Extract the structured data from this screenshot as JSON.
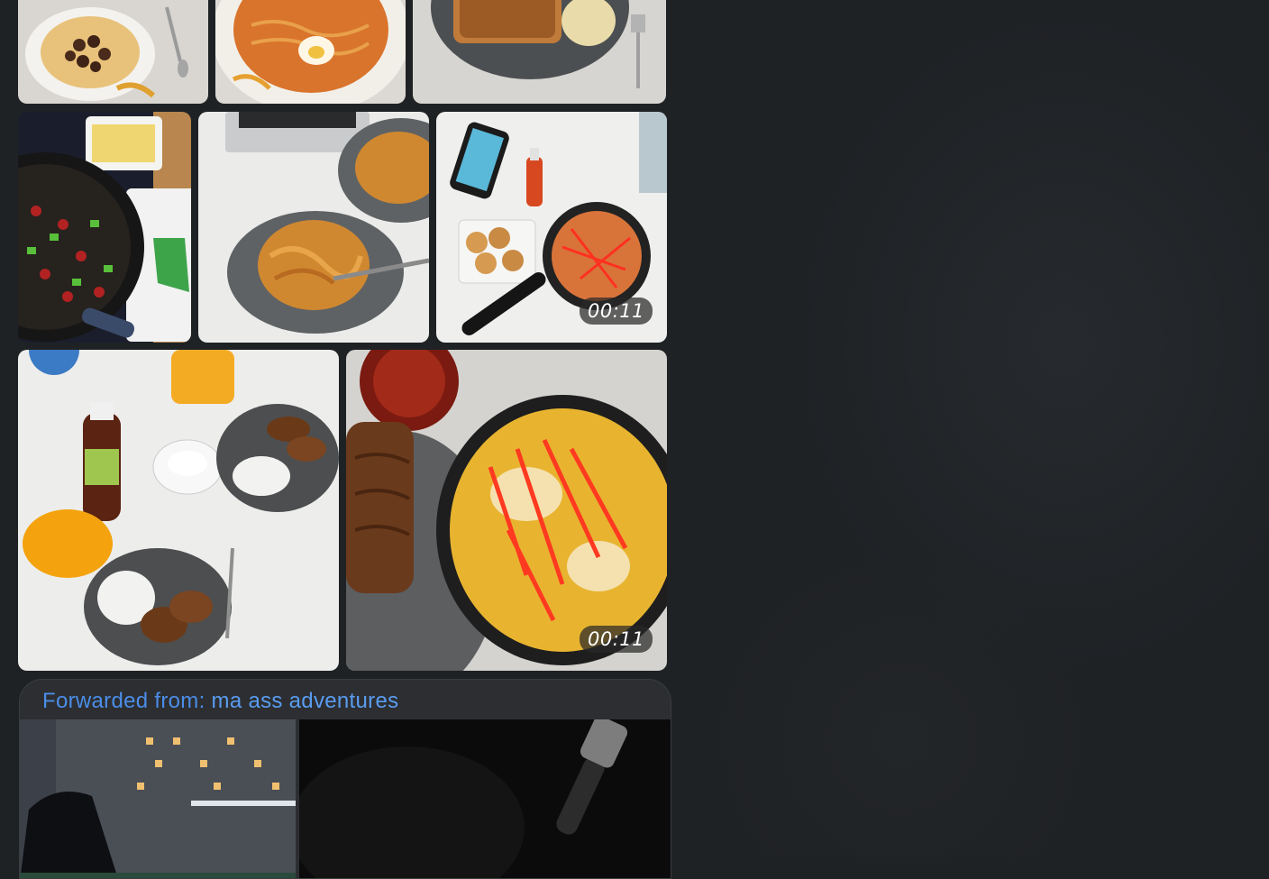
{
  "media": [
    {
      "id": "cereal-bowl",
      "kind": "photo"
    },
    {
      "id": "noodle-soup-with-egg",
      "kind": "photo"
    },
    {
      "id": "toast-sandwich",
      "kind": "photo"
    },
    {
      "id": "sausage-pan-cooking",
      "kind": "photo"
    },
    {
      "id": "tagliatelle-plates",
      "kind": "photo"
    },
    {
      "id": "pasta-pan-with-phone",
      "kind": "video",
      "duration": "00:11"
    },
    {
      "id": "rice-and-cutlets",
      "kind": "photo"
    },
    {
      "id": "omelette-pan-with-tea",
      "kind": "video",
      "duration": "00:11"
    }
  ],
  "forwarded": {
    "prefix": "Forwarded from:",
    "source": "ma ass adventures",
    "media": [
      {
        "id": "night-building",
        "kind": "photo"
      },
      {
        "id": "dark-photo",
        "kind": "photo"
      }
    ]
  },
  "colors": {
    "background": "#1f2225",
    "bubble": "#2c2e31",
    "link": "#4b8de8"
  }
}
